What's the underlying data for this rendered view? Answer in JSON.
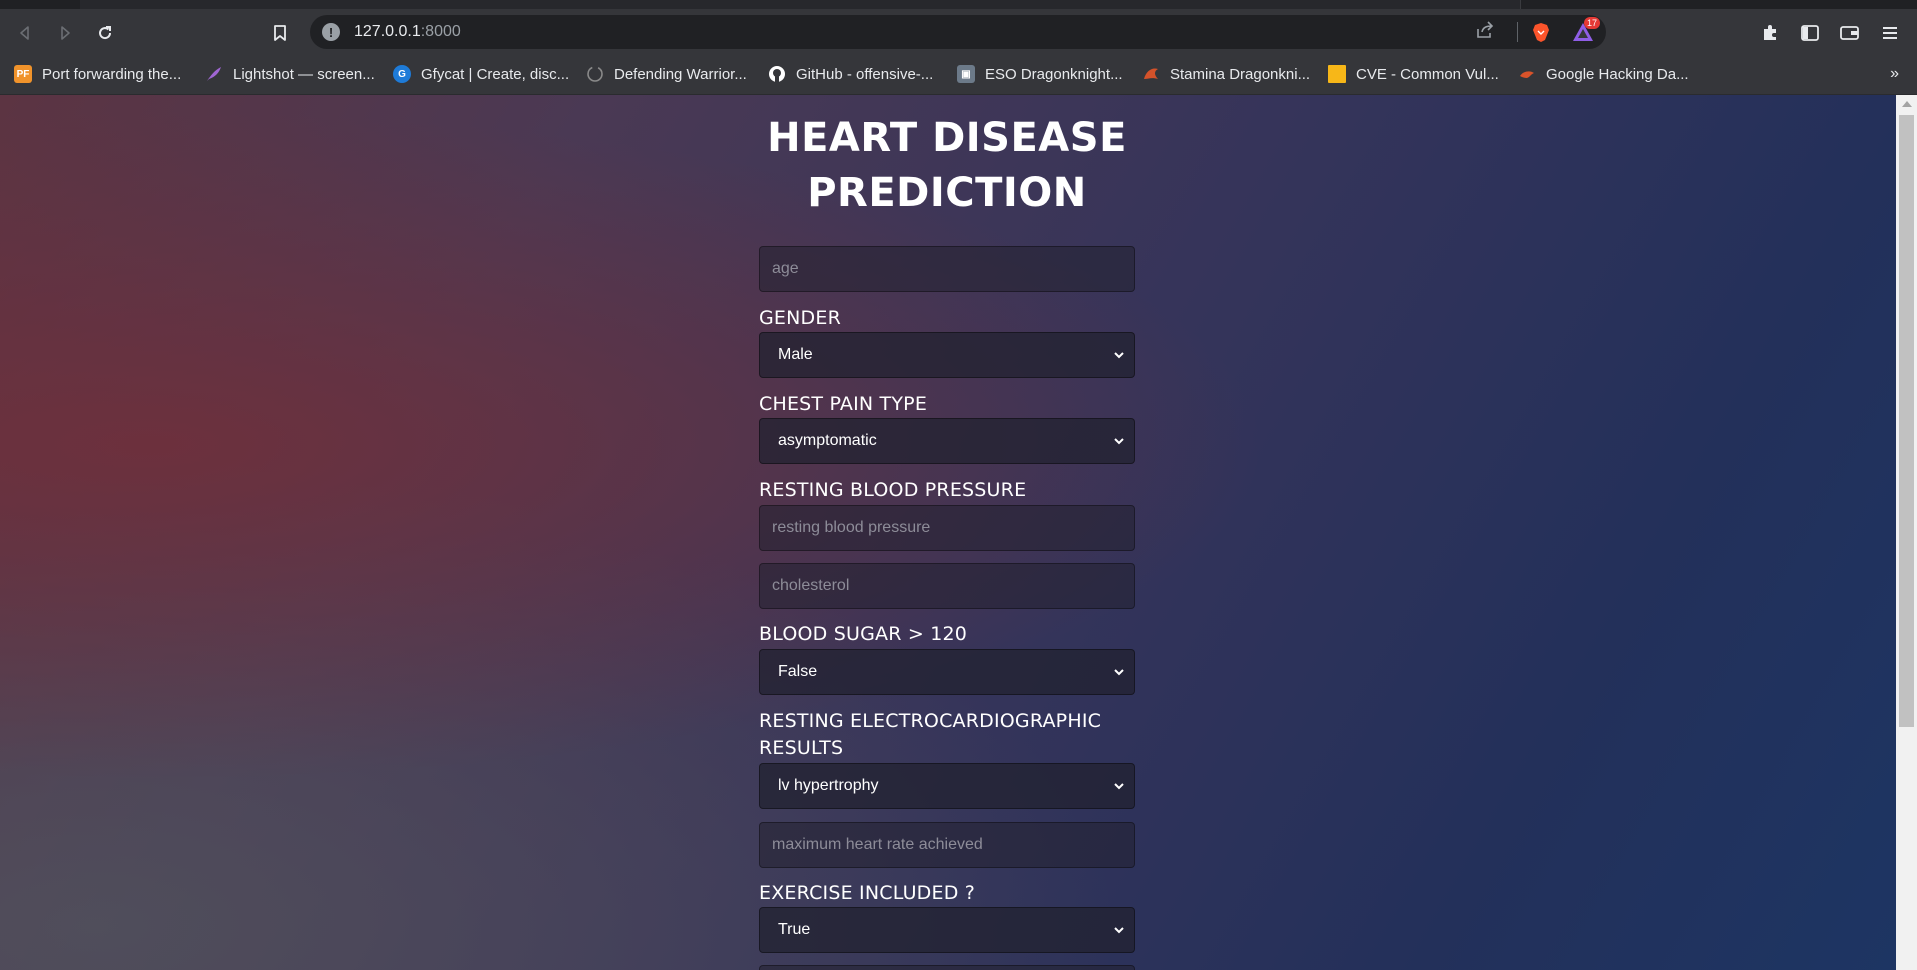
{
  "browser": {
    "url_host": "127.0.0.1",
    "url_port": ":8000",
    "rewards_badge": "17"
  },
  "bookmarks": [
    {
      "label": "Port forwarding the...",
      "icon": "pf-icon",
      "favicon_text": "PF",
      "color": "#f0932b"
    },
    {
      "label": "Lightshot — screen...",
      "icon": "feather-icon",
      "favicon_text": "",
      "color": "#a066d3"
    },
    {
      "label": "Gfycat | Create, disc...",
      "icon": "gfycat-icon",
      "favicon_text": "",
      "color": "#1e7bd8"
    },
    {
      "label": "Defending Warrior...",
      "icon": "circle-icon",
      "favicon_text": "",
      "color": "#3a3a3a"
    },
    {
      "label": "GitHub - offensive-...",
      "icon": "github-icon",
      "favicon_text": "",
      "color": "#ffffff"
    },
    {
      "label": "ESO Dragonknight...",
      "icon": "eso-icon",
      "favicon_text": "",
      "color": "#6c7a89"
    },
    {
      "label": "Stamina Dragonkni...",
      "icon": "dragon-icon",
      "favicon_text": "",
      "color": "#d4522a"
    },
    {
      "label": "CVE - Common Vul...",
      "icon": "cve-icon",
      "favicon_text": "",
      "color": "#f7b718"
    },
    {
      "label": "Google Hacking Da...",
      "icon": "ghdb-icon",
      "favicon_text": "",
      "color": "#d9532a"
    }
  ],
  "bookmarks_more": "»",
  "page": {
    "title": "HEART DISEASE PREDICTION",
    "age_placeholder": "age",
    "gender_label": "GENDER",
    "gender_value": "Male",
    "chest_pain_label": "CHEST PAIN TYPE",
    "chest_pain_value": "asymptomatic",
    "bp_label": "RESTING BLOOD PRESSURE",
    "bp_placeholder": "resting blood pressure",
    "cholesterol_placeholder": "cholesterol",
    "sugar_label": "BLOOD SUGAR > 120",
    "sugar_value": "False",
    "ecg_label": "RESTING ELECTROCARDIOGRAPHIC RESULTS",
    "ecg_value": "lv hypertrophy",
    "hr_placeholder": "maximum heart rate achieved",
    "exercise_label": "EXERCISE INCLUDED ?",
    "exercise_value": "True"
  }
}
